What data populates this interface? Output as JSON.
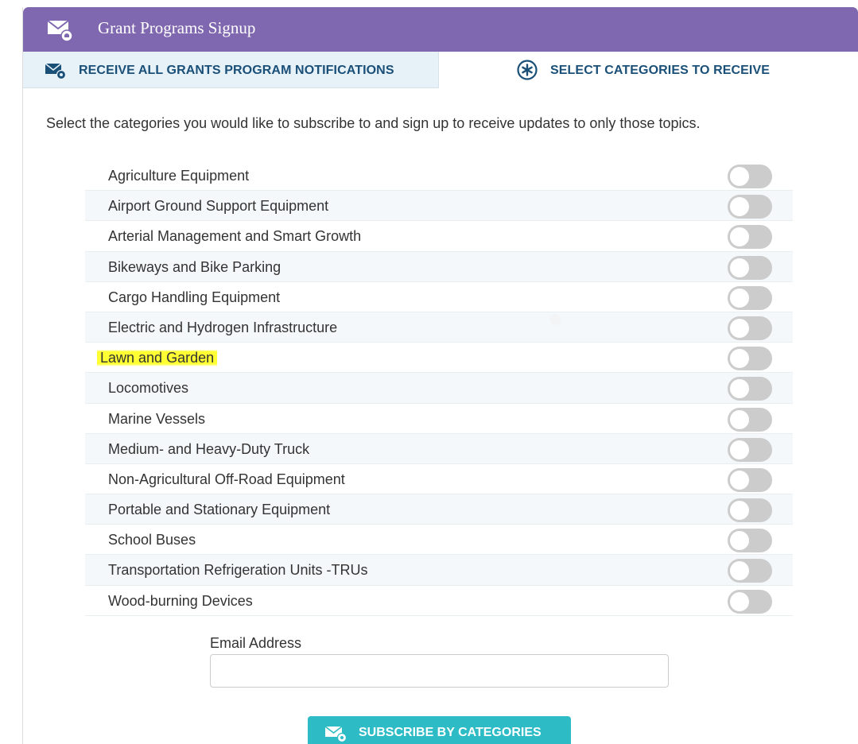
{
  "header": {
    "title": "Grant Programs Signup",
    "icon": "mail-bell-icon"
  },
  "tabs": {
    "all": {
      "label": "RECEIVE ALL GRANTS PROGRAM NOTIFICATIONS",
      "icon": "mail-bell-icon"
    },
    "categories": {
      "label": "SELECT CATEGORIES TO RECEIVE",
      "icon": "asterisk-circle-icon"
    }
  },
  "intro": "Select the categories you would like to subscribe to and sign up to receive updates to only those topics.",
  "categories": [
    {
      "label": "Agriculture Equipment",
      "enabled": false
    },
    {
      "label": "Airport Ground Support Equipment",
      "enabled": false
    },
    {
      "label": "Arterial Management and Smart Growth",
      "enabled": false
    },
    {
      "label": "Bikeways and Bike Parking",
      "enabled": false
    },
    {
      "label": "Cargo Handling Equipment",
      "enabled": false
    },
    {
      "label": "Electric and Hydrogen Infrastructure",
      "enabled": false
    },
    {
      "label": "Lawn and Garden",
      "enabled": false,
      "highlighted": true
    },
    {
      "label": "Locomotives",
      "enabled": false
    },
    {
      "label": "Marine Vessels",
      "enabled": false
    },
    {
      "label": "Medium- and Heavy-Duty Truck",
      "enabled": false
    },
    {
      "label": "Non-Agricultural Off-Road Equipment",
      "enabled": false
    },
    {
      "label": "Portable and Stationary Equipment",
      "enabled": false
    },
    {
      "label": "School Buses",
      "enabled": false
    },
    {
      "label": "Transportation Refrigeration Units -TRUs",
      "enabled": false
    },
    {
      "label": "Wood-burning Devices",
      "enabled": false
    }
  ],
  "email": {
    "label": "Email Address",
    "value": "",
    "placeholder": ""
  },
  "subscribe": {
    "label": "SUBSCRIBE BY CATEGORIES",
    "icon": "mail-bell-icon"
  },
  "colors": {
    "header_bg": "#8068b0",
    "tab_text": "#1a4f78",
    "tab_active_bg": "#e6f1f8",
    "button_bg": "#2dbcc6",
    "highlight": "#ffff33",
    "toggle_off": "#cccccc"
  }
}
